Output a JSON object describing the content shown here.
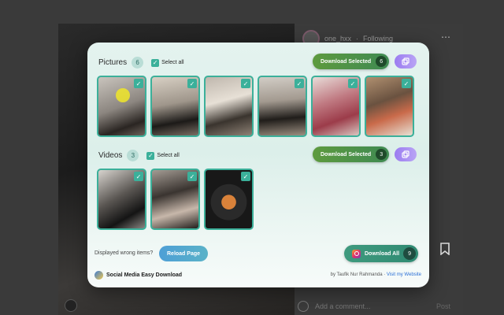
{
  "background": {
    "username": "one_hxx",
    "following": "Following",
    "comment_placeholder": "Add a comment...",
    "post_label": "Post",
    "more_icon": "more-dots-icon"
  },
  "modal": {
    "pictures": {
      "title": "Pictures",
      "count": "6",
      "select_all": "Select all",
      "download_label": "Download Selected",
      "download_count": "6",
      "items": [
        "thumb-1",
        "thumb-2",
        "thumb-3",
        "thumb-4",
        "thumb-5",
        "thumb-6"
      ]
    },
    "videos": {
      "title": "Videos",
      "count": "3",
      "select_all": "Select all",
      "download_label": "Download Selected",
      "download_count": "3",
      "items": [
        "video-1",
        "video-2",
        "video-3"
      ]
    },
    "wrong_items_text": "Displayed wrong items?",
    "reload_label": "Reload Page",
    "download_all_label": "Download All",
    "download_all_count": "9",
    "app_name": "Social Media Easy Download",
    "credit_prefix": "by Taufik Nur Rahmanda · ",
    "credit_link": "Visit my Website"
  },
  "colors": {
    "accent": "#3bb09a",
    "download_green": "#4f9246",
    "copy_purple": "#a88ff2",
    "reload_blue": "#4e9fd6"
  }
}
